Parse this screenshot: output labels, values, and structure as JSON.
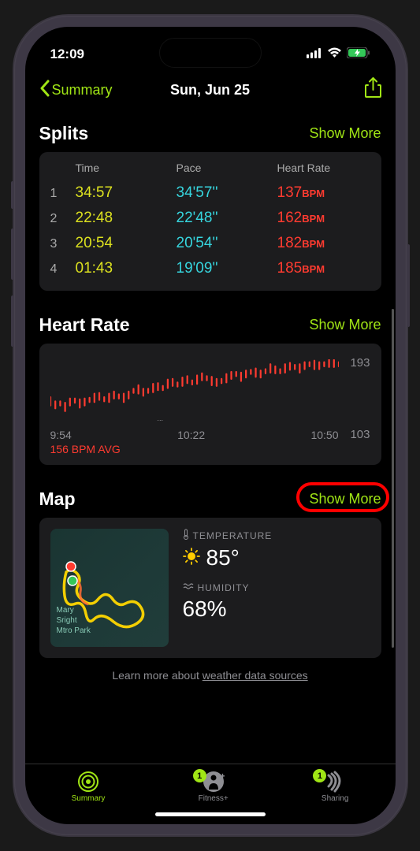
{
  "status": {
    "time": "12:09"
  },
  "nav": {
    "back_label": "Summary",
    "title": "Sun, Jun 25"
  },
  "splits": {
    "title": "Splits",
    "show_more": "Show More",
    "headers": {
      "time": "Time",
      "pace": "Pace",
      "hr": "Heart Rate"
    },
    "rows": [
      {
        "n": "1",
        "time": "34:57",
        "pace": "34'57''",
        "hr": "137",
        "unit": "BPM"
      },
      {
        "n": "2",
        "time": "22:48",
        "pace": "22'48''",
        "hr": "162",
        "unit": "BPM"
      },
      {
        "n": "3",
        "time": "20:54",
        "pace": "20'54''",
        "hr": "182",
        "unit": "BPM"
      },
      {
        "n": "4",
        "time": "01:43",
        "pace": "19'09''",
        "hr": "185",
        "unit": "BPM"
      }
    ]
  },
  "heart_rate": {
    "title": "Heart Rate",
    "show_more": "Show More",
    "max": "193",
    "min": "103",
    "avg": "156 BPM AVG",
    "times": {
      "t1": "9:54",
      "t2": "10:22",
      "t3": "10:50"
    }
  },
  "map": {
    "title": "Map",
    "show_more": "Show More",
    "park_label_1": "Mary",
    "park_label_2": "right",
    "park_label_3": "tro Park",
    "temp_label": "TEMPERATURE",
    "temp_value": "85°",
    "humidity_label": "HUMIDITY",
    "humidity_value": "68%",
    "source_prefix": "Learn more about ",
    "source_link": "weather data sources"
  },
  "tabs": {
    "summary": "Summary",
    "fitness": "Fitness+",
    "sharing": "Sharing",
    "badge_fitness": "1",
    "badge_sharing": "1"
  },
  "chart_data": {
    "type": "line",
    "title": "Heart Rate",
    "xlabel": "Time",
    "ylabel": "BPM",
    "ylim": [
      103,
      193
    ],
    "x_ticks": [
      "9:54",
      "10:22",
      "10:50"
    ],
    "avg": 156,
    "series": [
      {
        "name": "Heart Rate",
        "color": "#ff3b30",
        "values": [
          133,
          128,
          130,
          125,
          132,
          134,
          130,
          132,
          135,
          138,
          140,
          136,
          138,
          142,
          140,
          138,
          142,
          148,
          150,
          146,
          148,
          152,
          154,
          152,
          158,
          160,
          157,
          161,
          164,
          160,
          164,
          168,
          166,
          162,
          160,
          162,
          166,
          170,
          172,
          168,
          172,
          175,
          174,
          172,
          176,
          180,
          178,
          176,
          180,
          183,
          182,
          180,
          184,
          186,
          185,
          184,
          186,
          188,
          187,
          186
        ]
      }
    ]
  }
}
